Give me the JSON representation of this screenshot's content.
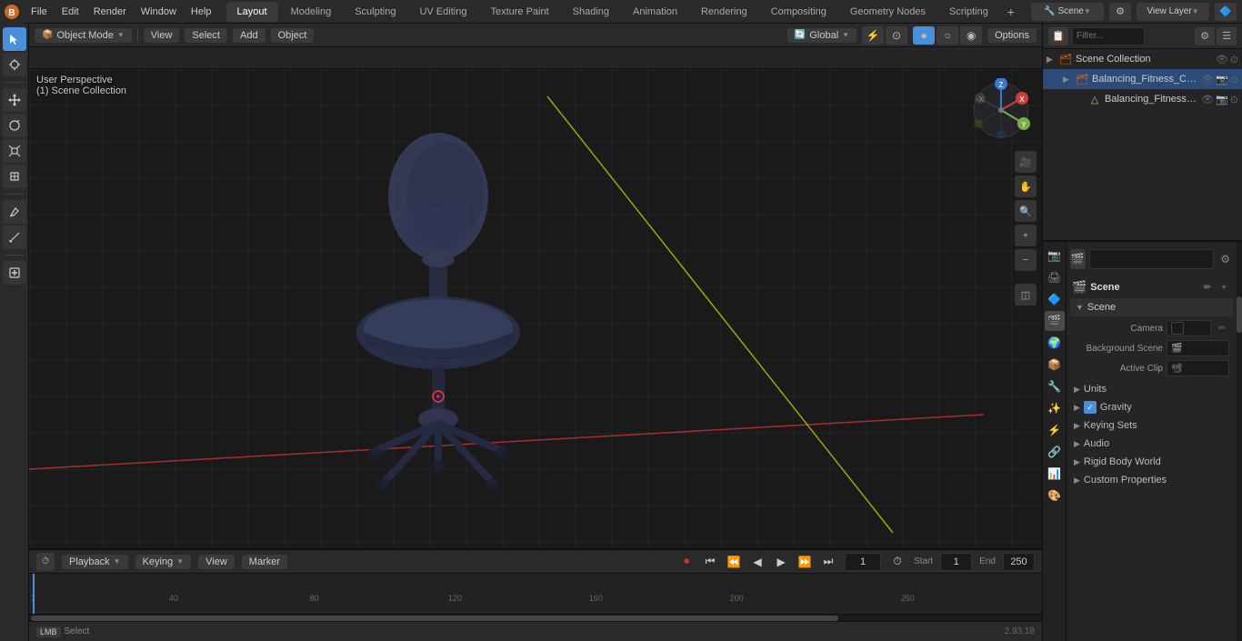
{
  "app": {
    "title": "Blender",
    "version": "2.93.18"
  },
  "top_menu": {
    "items": [
      "File",
      "Edit",
      "Render",
      "Window",
      "Help"
    ]
  },
  "workspace_tabs": {
    "tabs": [
      "Layout",
      "Modeling",
      "Sculpting",
      "UV Editing",
      "Texture Paint",
      "Shading",
      "Animation",
      "Rendering",
      "Compositing",
      "Geometry Nodes",
      "Scripting"
    ],
    "active": "Layout"
  },
  "viewport": {
    "mode": "Object Mode",
    "view_label": "View",
    "select_label": "Select",
    "add_label": "Add",
    "object_label": "Object",
    "perspective": "User Perspective",
    "collection": "(1) Scene Collection",
    "global_label": "Global",
    "options_label": "Options"
  },
  "outliner": {
    "title": "Scene Collection",
    "search_placeholder": "Filter...",
    "items": [
      {
        "label": "Balancing_Fitness_Chair_Blac",
        "indent": 0,
        "expanded": true,
        "icon": "collection"
      },
      {
        "label": "Balancing_Fitness_Chair_",
        "indent": 1,
        "expanded": false,
        "icon": "mesh"
      }
    ]
  },
  "properties": {
    "panel_title": "Scene",
    "scene_label": "Scene",
    "sections": {
      "scene": {
        "title": "Scene",
        "camera_label": "Camera",
        "background_scene_label": "Background Scene",
        "active_clip_label": "Active Clip"
      },
      "units": {
        "title": "Units",
        "collapsed": true
      },
      "gravity": {
        "title": "Gravity",
        "collapsed": true,
        "enabled": true
      },
      "keying_sets": {
        "title": "Keying Sets",
        "collapsed": true
      },
      "audio": {
        "title": "Audio",
        "collapsed": true
      },
      "rigid_body_world": {
        "title": "Rigid Body World",
        "collapsed": true
      },
      "custom_properties": {
        "title": "Custom Properties",
        "collapsed": true
      }
    }
  },
  "timeline": {
    "playback_label": "Playback",
    "keying_label": "Keying",
    "view_label": "View",
    "marker_label": "Marker",
    "current_frame": "1",
    "start_frame": "1",
    "end_frame": "250",
    "frame_markers": [
      0,
      40,
      80,
      120,
      160,
      200,
      250
    ],
    "frame_labels": [
      "1",
      "40",
      "80",
      "120",
      "160",
      "200",
      "250"
    ]
  },
  "status_bar": {
    "select_label": "Select",
    "version": "2.93.18"
  },
  "nav_gizmo": {
    "x_color": "#ee4444",
    "y_color": "#88cc44",
    "z_color": "#4488ee",
    "x_label": "X",
    "y_label": "Y",
    "z_label": "Z"
  }
}
